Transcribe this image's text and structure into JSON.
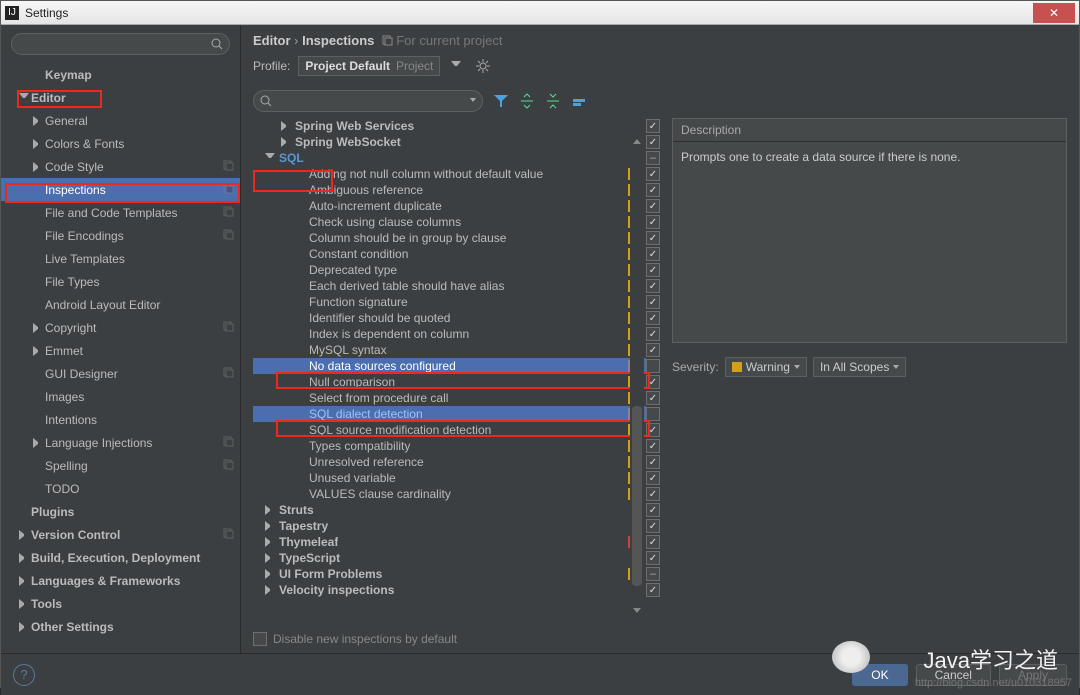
{
  "window": {
    "title": "Settings"
  },
  "breadcrumb": {
    "a": "Editor",
    "b": "Inspections",
    "c": "For current project"
  },
  "profile": {
    "label": "Profile:",
    "name": "Project Default",
    "scope": "Project"
  },
  "sidebar": {
    "items": [
      {
        "label": "Keymap",
        "depth": 1,
        "arrow": "none",
        "bold": true
      },
      {
        "label": "Editor",
        "depth": 0,
        "arrow": "open",
        "bold": true
      },
      {
        "label": "General",
        "depth": 1,
        "arrow": "closed"
      },
      {
        "label": "Colors & Fonts",
        "depth": 1,
        "arrow": "closed"
      },
      {
        "label": "Code Style",
        "depth": 1,
        "arrow": "closed",
        "copy": true
      },
      {
        "label": "Inspections",
        "depth": 1,
        "arrow": "none",
        "copy": true,
        "selected": true
      },
      {
        "label": "File and Code Templates",
        "depth": 1,
        "arrow": "none",
        "copy": true
      },
      {
        "label": "File Encodings",
        "depth": 1,
        "arrow": "none",
        "copy": true
      },
      {
        "label": "Live Templates",
        "depth": 1,
        "arrow": "none"
      },
      {
        "label": "File Types",
        "depth": 1,
        "arrow": "none"
      },
      {
        "label": "Android Layout Editor",
        "depth": 1,
        "arrow": "none"
      },
      {
        "label": "Copyright",
        "depth": 1,
        "arrow": "closed",
        "copy": true
      },
      {
        "label": "Emmet",
        "depth": 1,
        "arrow": "closed"
      },
      {
        "label": "GUI Designer",
        "depth": 1,
        "arrow": "none",
        "copy": true
      },
      {
        "label": "Images",
        "depth": 1,
        "arrow": "none"
      },
      {
        "label": "Intentions",
        "depth": 1,
        "arrow": "none"
      },
      {
        "label": "Language Injections",
        "depth": 1,
        "arrow": "closed",
        "copy": true
      },
      {
        "label": "Spelling",
        "depth": 1,
        "arrow": "none",
        "copy": true
      },
      {
        "label": "TODO",
        "depth": 1,
        "arrow": "none"
      },
      {
        "label": "Plugins",
        "depth": 0,
        "arrow": "none",
        "bold": true
      },
      {
        "label": "Version Control",
        "depth": 0,
        "arrow": "closed",
        "bold": true,
        "copy": true
      },
      {
        "label": "Build, Execution, Deployment",
        "depth": 0,
        "arrow": "closed",
        "bold": true
      },
      {
        "label": "Languages & Frameworks",
        "depth": 0,
        "arrow": "closed",
        "bold": true
      },
      {
        "label": "Tools",
        "depth": 0,
        "arrow": "closed",
        "bold": true
      },
      {
        "label": "Other Settings",
        "depth": 0,
        "arrow": "closed",
        "bold": true
      }
    ]
  },
  "inspections": [
    {
      "t": "Spring Web Services",
      "d": 1,
      "a": "closed",
      "b": true,
      "m": "",
      "c": "on"
    },
    {
      "t": "Spring WebSocket",
      "d": 1,
      "a": "closed",
      "b": true,
      "m": "",
      "c": "on"
    },
    {
      "t": "SQL",
      "d": 0,
      "a": "open",
      "b": true,
      "sql": true,
      "m": "",
      "c": "dash"
    },
    {
      "t": "Adding not null column without default value",
      "d": 2,
      "m": "y",
      "c": "on"
    },
    {
      "t": "Ambiguous reference",
      "d": 2,
      "m": "y",
      "c": "on"
    },
    {
      "t": "Auto-increment duplicate",
      "d": 2,
      "m": "y",
      "c": "on"
    },
    {
      "t": "Check using clause columns",
      "d": 2,
      "m": "y",
      "c": "on"
    },
    {
      "t": "Column should be in group by clause",
      "d": 2,
      "m": "y",
      "c": "on"
    },
    {
      "t": "Constant condition",
      "d": 2,
      "m": "y",
      "c": "on"
    },
    {
      "t": "Deprecated type",
      "d": 2,
      "m": "y",
      "c": "on"
    },
    {
      "t": "Each derived table should have alias",
      "d": 2,
      "m": "y",
      "c": "on"
    },
    {
      "t": "Function signature",
      "d": 2,
      "m": "y",
      "c": "on"
    },
    {
      "t": "Identifier should be quoted",
      "d": 2,
      "m": "y",
      "c": "on"
    },
    {
      "t": "Index is dependent on column",
      "d": 2,
      "m": "y",
      "c": "on"
    },
    {
      "t": "MySQL syntax",
      "d": 2,
      "m": "y",
      "c": "on"
    },
    {
      "t": "No data sources configured",
      "d": 2,
      "m": "g",
      "c": "off",
      "sel": true
    },
    {
      "t": "Null comparison",
      "d": 2,
      "m": "y",
      "c": "on"
    },
    {
      "t": "Select from procedure call",
      "d": 2,
      "m": "y",
      "c": "on"
    },
    {
      "t": "SQL dialect detection",
      "d": 2,
      "m": "g",
      "c": "off",
      "sel": true,
      "link": true
    },
    {
      "t": "SQL source modification detection",
      "d": 2,
      "m": "y",
      "c": "on"
    },
    {
      "t": "Types compatibility",
      "d": 2,
      "m": "y",
      "c": "on"
    },
    {
      "t": "Unresolved reference",
      "d": 2,
      "m": "y",
      "c": "on"
    },
    {
      "t": "Unused variable",
      "d": 2,
      "m": "y",
      "c": "on"
    },
    {
      "t": "VALUES clause cardinality",
      "d": 2,
      "m": "y",
      "c": "on"
    },
    {
      "t": "Struts",
      "d": 0,
      "a": "closed",
      "b": true,
      "m": "",
      "c": "on"
    },
    {
      "t": "Tapestry",
      "d": 0,
      "a": "closed",
      "b": true,
      "m": "",
      "c": "on"
    },
    {
      "t": "Thymeleaf",
      "d": 0,
      "a": "closed",
      "b": true,
      "m": "r",
      "c": "on"
    },
    {
      "t": "TypeScript",
      "d": 0,
      "a": "closed",
      "b": true,
      "m": "",
      "c": "on"
    },
    {
      "t": "UI Form Problems",
      "d": 0,
      "a": "closed",
      "b": true,
      "m": "y",
      "c": "dash"
    },
    {
      "t": "Velocity inspections",
      "d": 0,
      "a": "closed",
      "b": true,
      "m": "",
      "c": "on"
    }
  ],
  "description": {
    "header": "Description",
    "body": "Prompts one to create a data source if there is none."
  },
  "severity": {
    "label": "Severity:",
    "value": "Warning",
    "scope": "In All Scopes"
  },
  "disable": "Disable new inspections by default",
  "buttons": {
    "ok": "OK",
    "cancel": "Cancel",
    "apply": "Apply"
  },
  "watermark": "http://blog.csdn.net/u010318957",
  "wechat": "Java学习之道"
}
